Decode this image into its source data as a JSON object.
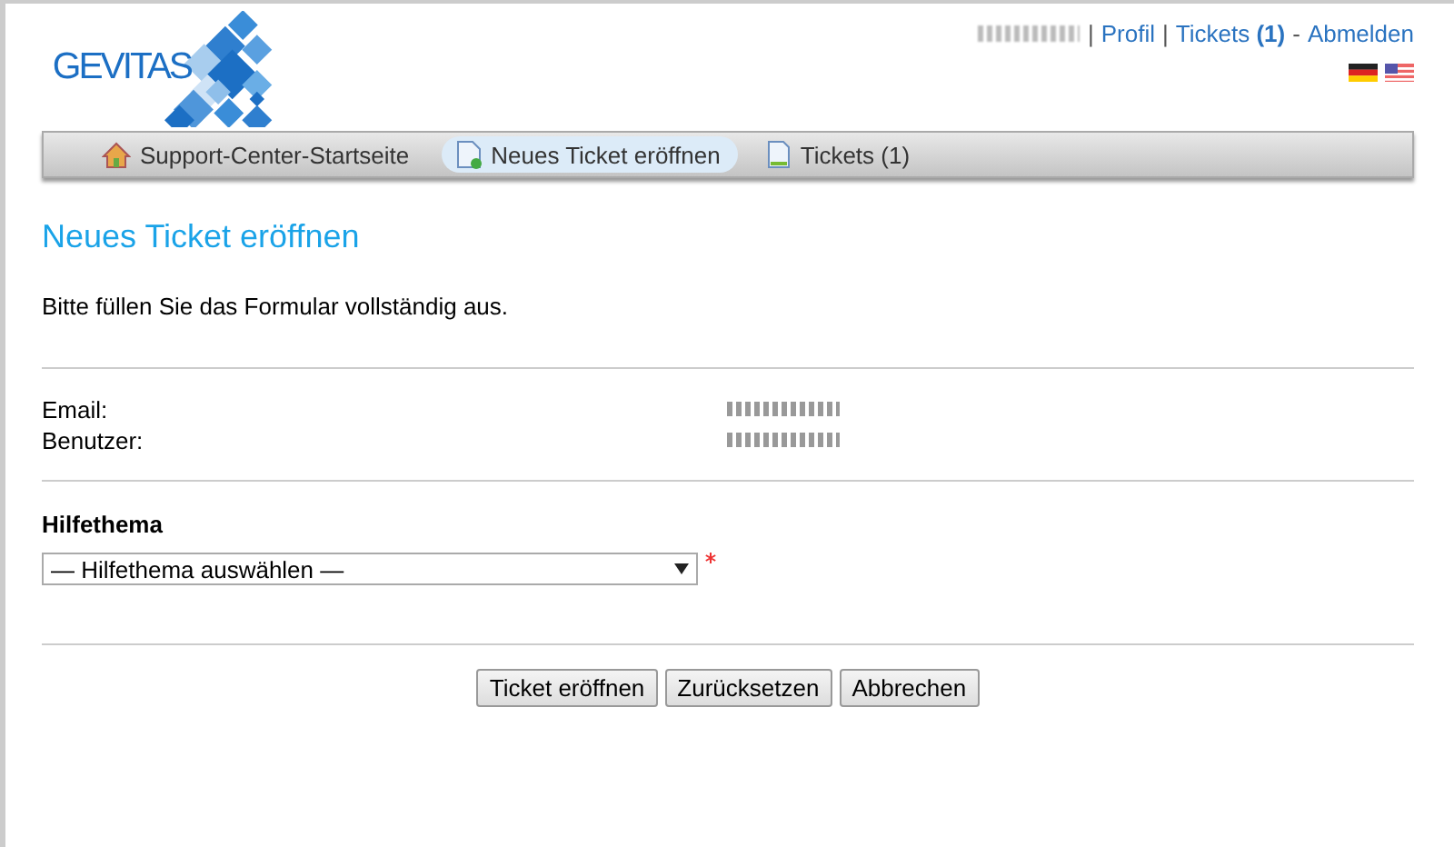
{
  "header": {
    "logo": "GEVITAS",
    "user": {
      "redacted": true
    },
    "links": [
      {
        "label": "Profil",
        "separator": "|"
      },
      {
        "label": "Tickets",
        "count": "(1)",
        "separator": "|"
      },
      {
        "label": "Abmelden",
        "separator": "-"
      }
    ],
    "languages": [
      {
        "kind": "de"
      },
      {
        "kind": "us"
      }
    ]
  },
  "nav": [
    {
      "label": "Support-Center-Startseite",
      "kind": "home",
      "selected": false
    },
    {
      "label": "Neues Ticket eröffnen",
      "kind": "new",
      "selected": true
    },
    {
      "label": "Tickets (1)",
      "kind": "tickets",
      "selected": false
    }
  ],
  "page": {
    "title": "Neues Ticket eröffnen",
    "intro": "Bitte füllen Sie das Formular vollständig aus.",
    "info": [
      {
        "label": "Email:",
        "redacted": true
      },
      {
        "label": "Benutzer:",
        "redacted": true
      }
    ],
    "topic": {
      "label": "Hilfethema",
      "value": "— Hilfethema auswählen —",
      "required": true
    }
  },
  "buttons": [
    "Ticket eröffnen",
    "Zurücksetzen",
    "Abbrechen"
  ]
}
